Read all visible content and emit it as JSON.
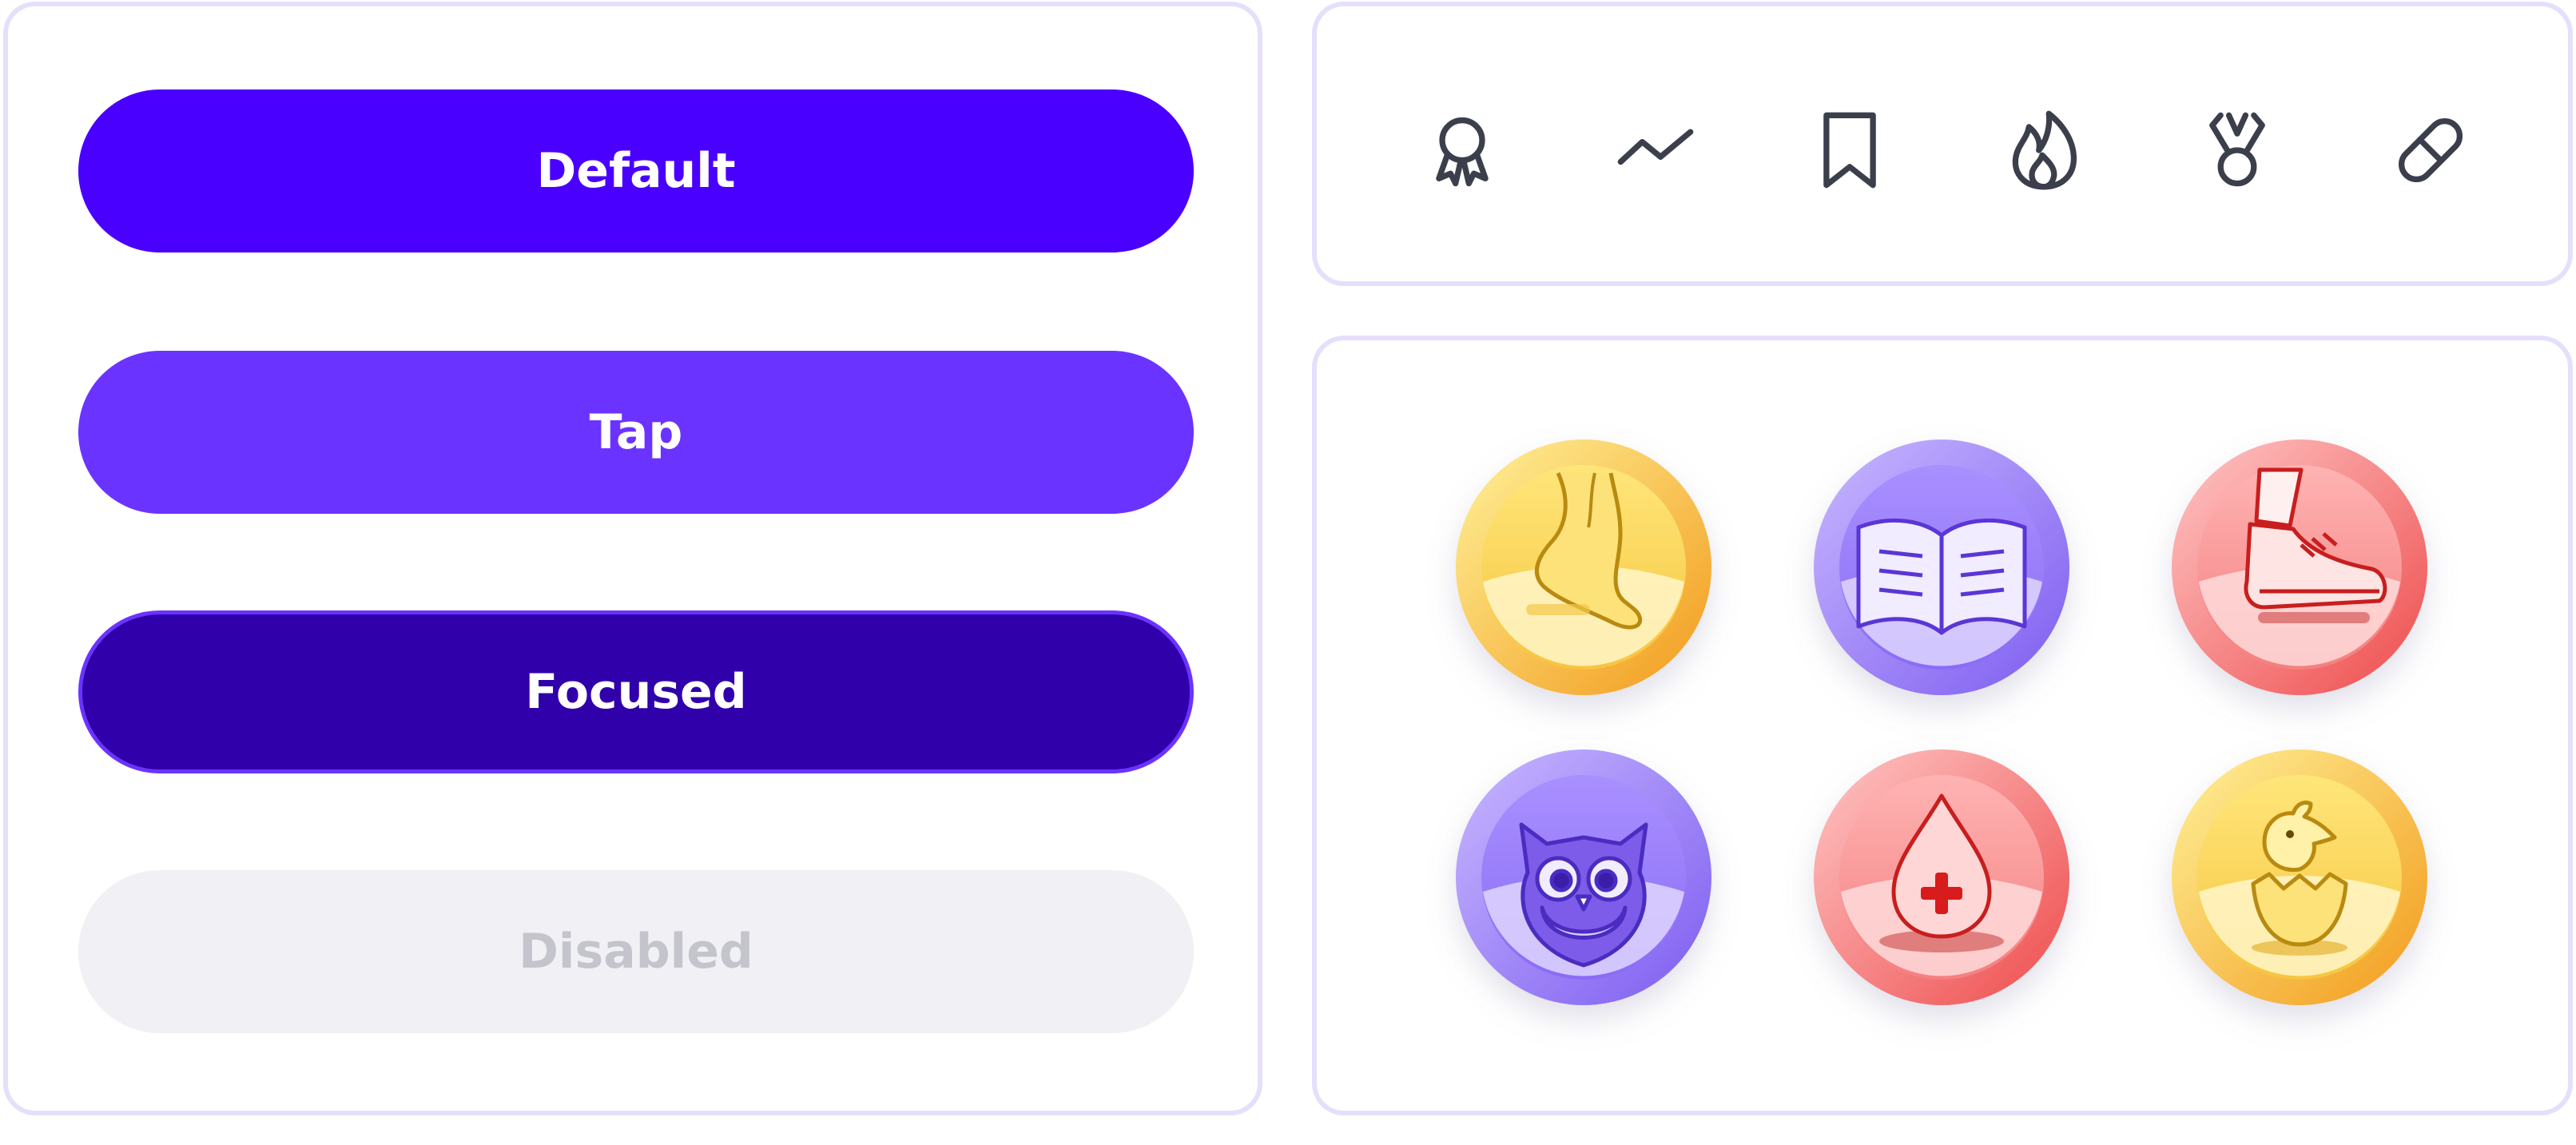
{
  "buttons": {
    "default_label": "Default",
    "tap_label": "Tap",
    "focused_label": "Focused",
    "disabled_label": "Disabled"
  },
  "icons": [
    "award-ribbon-icon",
    "trend-line-icon",
    "bookmark-icon",
    "flame-icon",
    "medal-icon",
    "pill-icon"
  ],
  "badges": [
    "foot-badge",
    "book-badge",
    "sneaker-badge",
    "owl-badge",
    "blood-drop-badge",
    "chick-badge"
  ],
  "colors": {
    "primary": "#4a00ff",
    "tap": "#6b33ff",
    "focused": "#3000aa",
    "disabled_bg": "#f0f0f5",
    "disabled_text": "#c4c4cc",
    "panel_border": "#e6dffb",
    "icon_stroke": "#3a3f4b"
  }
}
